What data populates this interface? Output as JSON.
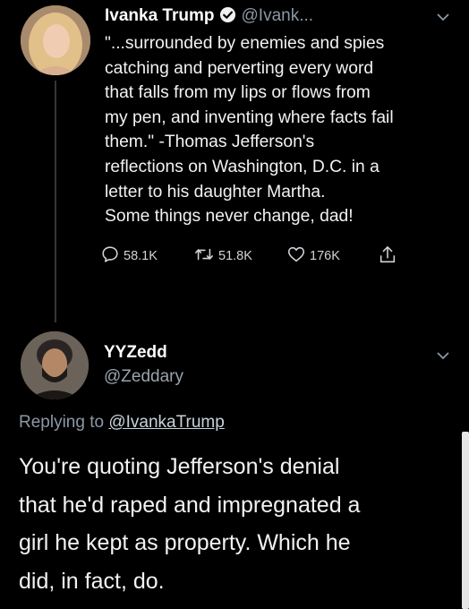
{
  "tweet1": {
    "name": "Ivanka Trump",
    "handle": "@Ivank...",
    "lines": [
      "\"...surrounded by enemies and spies",
      "catching and perverting every word",
      "that falls from my lips or flows from",
      "my pen, and inventing where facts fail",
      "them.\" -Thomas Jefferson's",
      "reflections on Washington, D.C. in a",
      "letter to his daughter Martha.",
      "Some things never change, dad!"
    ],
    "actions": {
      "reply_count": "58.1K",
      "retweet_count": "51.8K",
      "like_count": "176K"
    }
  },
  "tweet2": {
    "name": "YYZedd",
    "handle": "@Zeddary",
    "replying_prefix": "Replying to",
    "replying_handle": "@IvankaTrump",
    "lines": [
      "You're quoting Jefferson's denial",
      "that he'd raped and impregnated a",
      "girl he kept as property. Which he",
      "did, in fact, do."
    ]
  },
  "icons": {
    "verified": "verified-badge-icon",
    "chevron": "chevron-down-icon",
    "reply": "reply-icon",
    "retweet": "retweet-icon",
    "like": "heart-icon",
    "share": "share-icon"
  },
  "colors": {
    "background": "#000000",
    "text": "#e7e9ea",
    "secondary": "#8b98a5"
  }
}
